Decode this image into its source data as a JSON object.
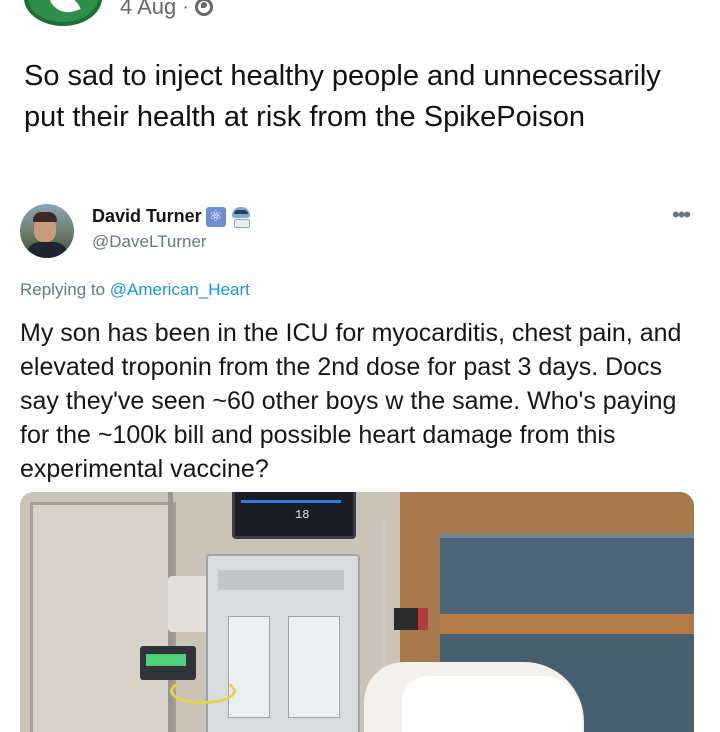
{
  "post": {
    "date": "4 Aug",
    "separator": "·",
    "privacy_icon": "globe-icon",
    "text": "So sad to inject healthy people and unnecessarily put their health at risk from the SpikePoison"
  },
  "tweet": {
    "display_name": "David Turner",
    "handle": "@DaveLTurner",
    "badges": [
      "atom-emoji-icon",
      "mask-face-emoji-icon"
    ],
    "replying_prefix": "Replying to",
    "replying_to": "@American_Heart",
    "text": "My son has been in the ICU for myocarditis, chest pain, and elevated troponin from the 2nd dose for past 3 days. Docs say they've seen ~60 other boys w the same. Who's paying for the ~100k bill and possible heart damage from this experimental vaccine?",
    "more_icon": "more-options-icon",
    "photo": {
      "monitor_reading": "18",
      "colors": {
        "wall": "#c9c3b8",
        "wood_panel": "#a7794c",
        "blue_panel": "#4c6578"
      }
    }
  },
  "colors": {
    "brand_green": "#2f8f4a",
    "secondary_text": "#65676b",
    "link_blue": "#1b95e0"
  }
}
